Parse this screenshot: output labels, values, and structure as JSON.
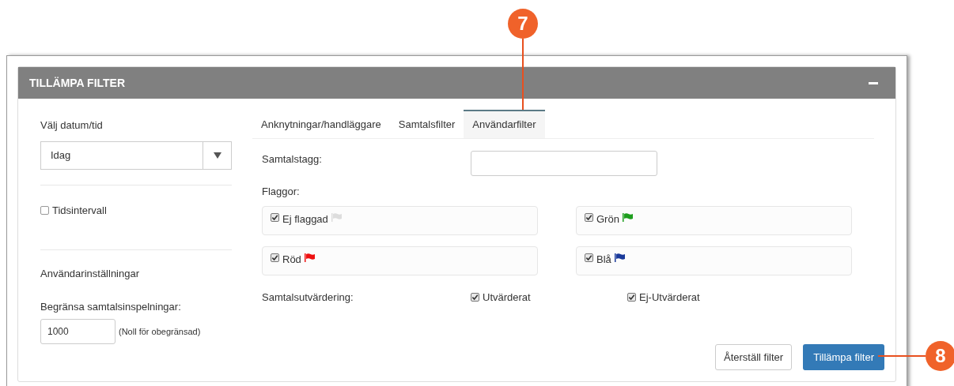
{
  "callouts": [
    {
      "label": "7"
    },
    {
      "label": "8"
    }
  ],
  "panel": {
    "title": "TILLÄMPA FILTER"
  },
  "left": {
    "date_label": "Välj datum/tid",
    "date_select": {
      "value": "Idag"
    },
    "time_interval": {
      "label": "Tidsintervall",
      "checked": false
    },
    "user_settings_heading": "Användarinställningar",
    "limit_label": "Begränsa samtalsinspelningar:",
    "limit_field": {
      "value": "1000"
    },
    "limit_hint": "(Noll för obegränsad)"
  },
  "tabs": [
    {
      "label": "Anknytningar/handläggare",
      "selected": false
    },
    {
      "label": "Samtalsfilter",
      "selected": false
    },
    {
      "label": "Användarfilter",
      "selected": true
    }
  ],
  "call_tag": {
    "label": "Samtalstagg:"
  },
  "flags_label": "Flaggor:",
  "flags": [
    {
      "label": "Ej flaggad",
      "checked": true,
      "color": "#dddddd"
    },
    {
      "label": "Grön",
      "checked": true,
      "color": "#1e9e1e"
    },
    {
      "label": "Röd",
      "checked": true,
      "color": "#ee1111"
    },
    {
      "label": "Blå",
      "checked": true,
      "color": "#1a3a9a"
    }
  ],
  "evaluation": {
    "label": "Samtalsutvärdering:",
    "options": [
      {
        "label": "Utvärderat",
        "checked": true
      },
      {
        "label": "Ej-Utvärderat",
        "checked": true
      }
    ]
  },
  "buttons": {
    "reset": "Återställ filter",
    "apply": "Tillämpa filter"
  }
}
